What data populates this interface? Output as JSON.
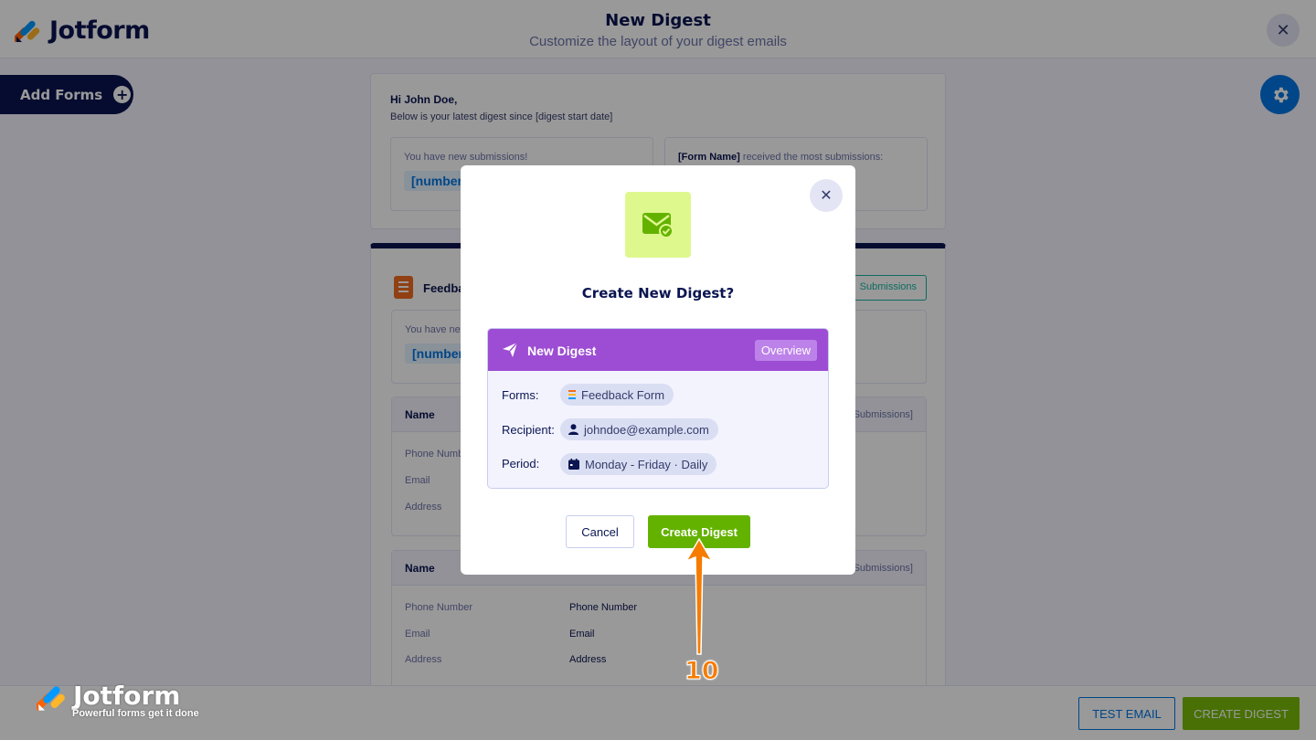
{
  "app": {
    "brand": "Jotform",
    "title": "New Digest",
    "subtitle": "Customize the layout of your digest emails",
    "add_forms_label": "Add Forms"
  },
  "preview": {
    "greeting": "Hi John Doe,",
    "greeting_sub": "Below is your latest digest since [digest start date]",
    "new_submissions_label": "You have new submissions!",
    "number_placeholder": "[number",
    "most_submissions_prefix": "[Form Name]",
    "most_submissions_suffix": " received the most submissions:",
    "form_name": "Feedba",
    "view_submissions": "Submissions",
    "you_have_new": "You have nev",
    "tables": [
      {
        "header": "Name",
        "header_right": "Submissions]",
        "rows": [
          {
            "label": "Phone Numb",
            "value": ""
          },
          {
            "label": "Email",
            "value": ""
          },
          {
            "label": "Address",
            "value": ""
          }
        ]
      },
      {
        "header": "Name",
        "header_right": "Submissions]",
        "rows": [
          {
            "label": "Phone Number",
            "value": "Phone Number"
          },
          {
            "label": "Email",
            "value": "Email"
          },
          {
            "label": "Address",
            "value": "Address"
          }
        ]
      }
    ]
  },
  "footer": {
    "brand": "Jotform",
    "tagline": "Powerful forms get it done",
    "test_email": "TEST EMAIL",
    "create_digest": "CREATE DIGEST"
  },
  "modal": {
    "title": "Create New Digest?",
    "digest_name": "New Digest",
    "overview_label": "Overview",
    "forms_label": "Forms:",
    "forms_value": "Feedback Form",
    "recipient_label": "Recipient:",
    "recipient_value": "johndoe@example.com",
    "period_label": "Period:",
    "period_value": "Monday - Friday · Daily",
    "cancel_label": "Cancel",
    "create_label": "Create Digest"
  },
  "annotation": {
    "step_number": "10"
  },
  "colors": {
    "navy": "#0a1551",
    "blue": "#0075e3",
    "green": "#64b200",
    "purple": "#9c4dd3",
    "orange_annotation": "#f57c00"
  }
}
